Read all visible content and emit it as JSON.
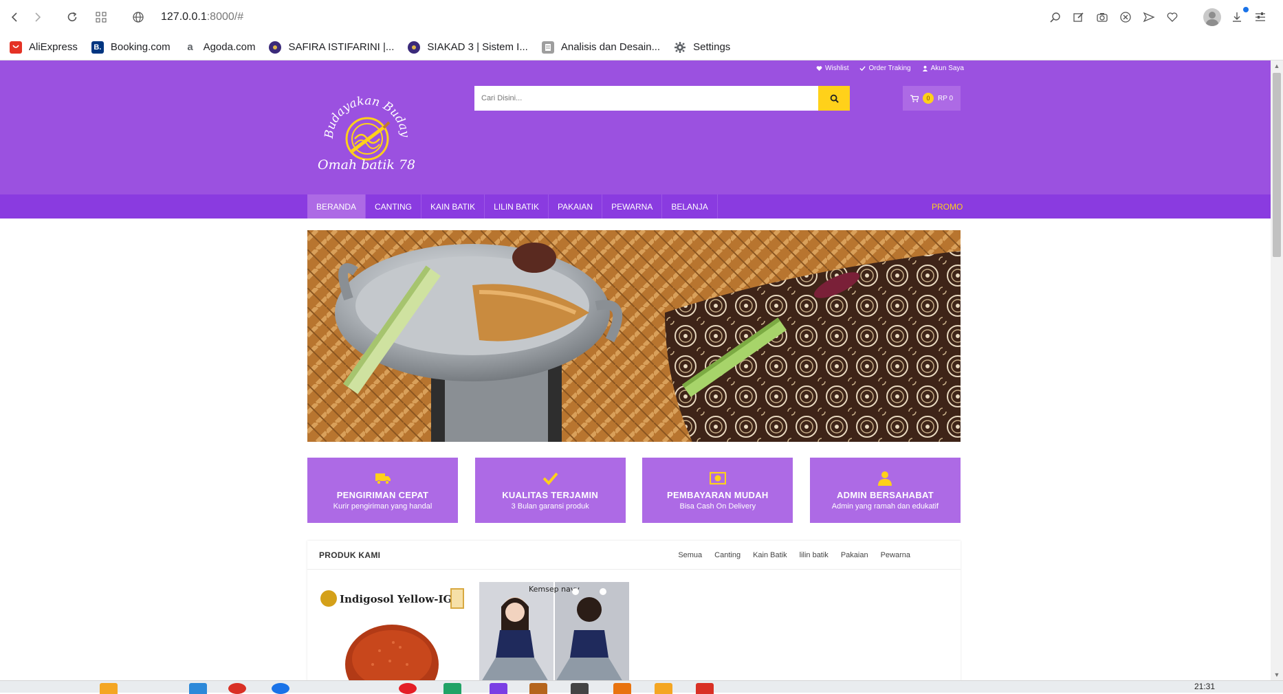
{
  "browser": {
    "url_host": "127.0.0.1",
    "url_rest": ":8000/#",
    "bookmarks": [
      {
        "label": "AliExpress",
        "icon": "aliexpress-icon",
        "color": "#e43225"
      },
      {
        "label": "Booking.com",
        "icon": "booking-icon",
        "color": "#003580"
      },
      {
        "label": "Agoda.com",
        "icon": "agoda-icon",
        "color": "#5f6368"
      },
      {
        "label": "SAFIRA ISTIFARINI |...",
        "icon": "university-seal-icon",
        "color": "#3b2a7a"
      },
      {
        "label": "SIAKAD 3 | Sistem I...",
        "icon": "university-seal-icon",
        "color": "#3b2a7a"
      },
      {
        "label": "Analisis dan Desain...",
        "icon": "document-icon",
        "color": "#777777"
      },
      {
        "label": "Settings",
        "icon": "gear-icon",
        "color": "#5f6368"
      }
    ]
  },
  "header": {
    "links": [
      "Wishlist",
      "Order Traking",
      "Akun Saya"
    ],
    "search_placeholder": "Cari Disini...",
    "cart_count": "0",
    "cart_total": "RP 0",
    "logo_text_top": "Budayakan Budaya",
    "logo_text_bottom": "Omah batik 78"
  },
  "menu": {
    "items": [
      "BERANDA",
      "CANTING",
      "KAIN BATIK",
      "LILIN BATIK",
      "PAKAIAN",
      "PEWARNA",
      "BELANJA"
    ],
    "promo": "PROMO"
  },
  "features": [
    {
      "title": "PENGIRIMAN CEPAT",
      "sub": "Kurir pengiriman yang handal",
      "icon": "truck-icon"
    },
    {
      "title": "KUALITAS TERJAMIN",
      "sub": "3 Bulan garansi produk",
      "icon": "check-icon"
    },
    {
      "title": "PEMBAYARAN MUDAH",
      "sub": "Bisa Cash On Delivery",
      "icon": "money-icon"
    },
    {
      "title": "ADMIN BERSAHABAT",
      "sub": "Admin yang ramah dan edukatif",
      "icon": "user-icon"
    }
  ],
  "products": {
    "title": "PRODUK KAMI",
    "tabs": [
      "Semua",
      "Canting",
      "Kain Batik",
      "lilin batik",
      "Pakaian",
      "Pewarna"
    ],
    "items": [
      {
        "label": "Indigosol Yellow-IGK"
      },
      {
        "label": "Kemsep navy"
      }
    ]
  },
  "taskbar": {
    "time": "21:31"
  },
  "colors": {
    "primary": "#9b51e0",
    "menu": "#8a3be0",
    "accent": "#ffd11a",
    "card": "#ad6ae5"
  }
}
